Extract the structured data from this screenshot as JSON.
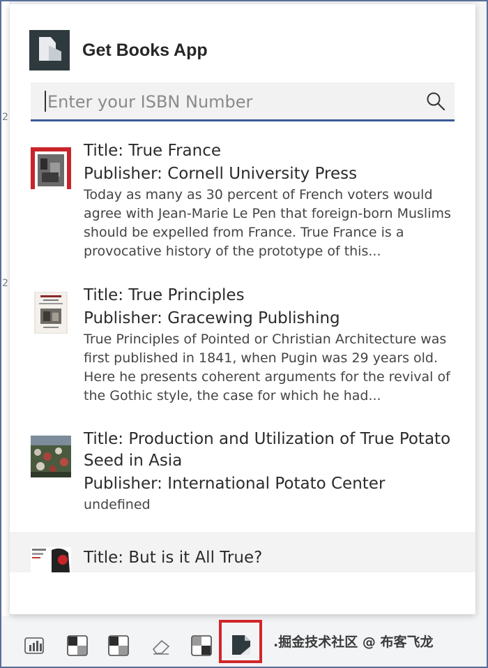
{
  "app": {
    "title": "Get Books App"
  },
  "search": {
    "placeholder": "Enter your ISBN Number",
    "value": ""
  },
  "results": [
    {
      "title": "Title: True France",
      "publisher": "Publisher: Cornell University Press",
      "description": "Today as many as 30 percent of French voters would agree with Jean-Marie Le Pen that foreign-born Muslims should be expelled from France. True France is a provocative history of the prototype of this..."
    },
    {
      "title": "Title: True Principles",
      "publisher": "Publisher: Gracewing Publishing",
      "description": "True Principles of Pointed or Christian Architecture was first published in 1841, when Pugin was 29 years old. Here he presents coherent arguments for the revival of the Gothic style, the case for which he had..."
    },
    {
      "title": "Title: Production and Utilization of True Potato Seed in Asia",
      "publisher": "Publisher: International Potato Center",
      "description": "undefined"
    },
    {
      "title": "Title: But is it All True?"
    }
  ],
  "watermark": ".掘金技术社区 @ 布客飞龙",
  "background_marks": [
    "2",
    "2"
  ],
  "colors": {
    "accent": "#3d5a99",
    "highlight_border": "#d0262a"
  }
}
